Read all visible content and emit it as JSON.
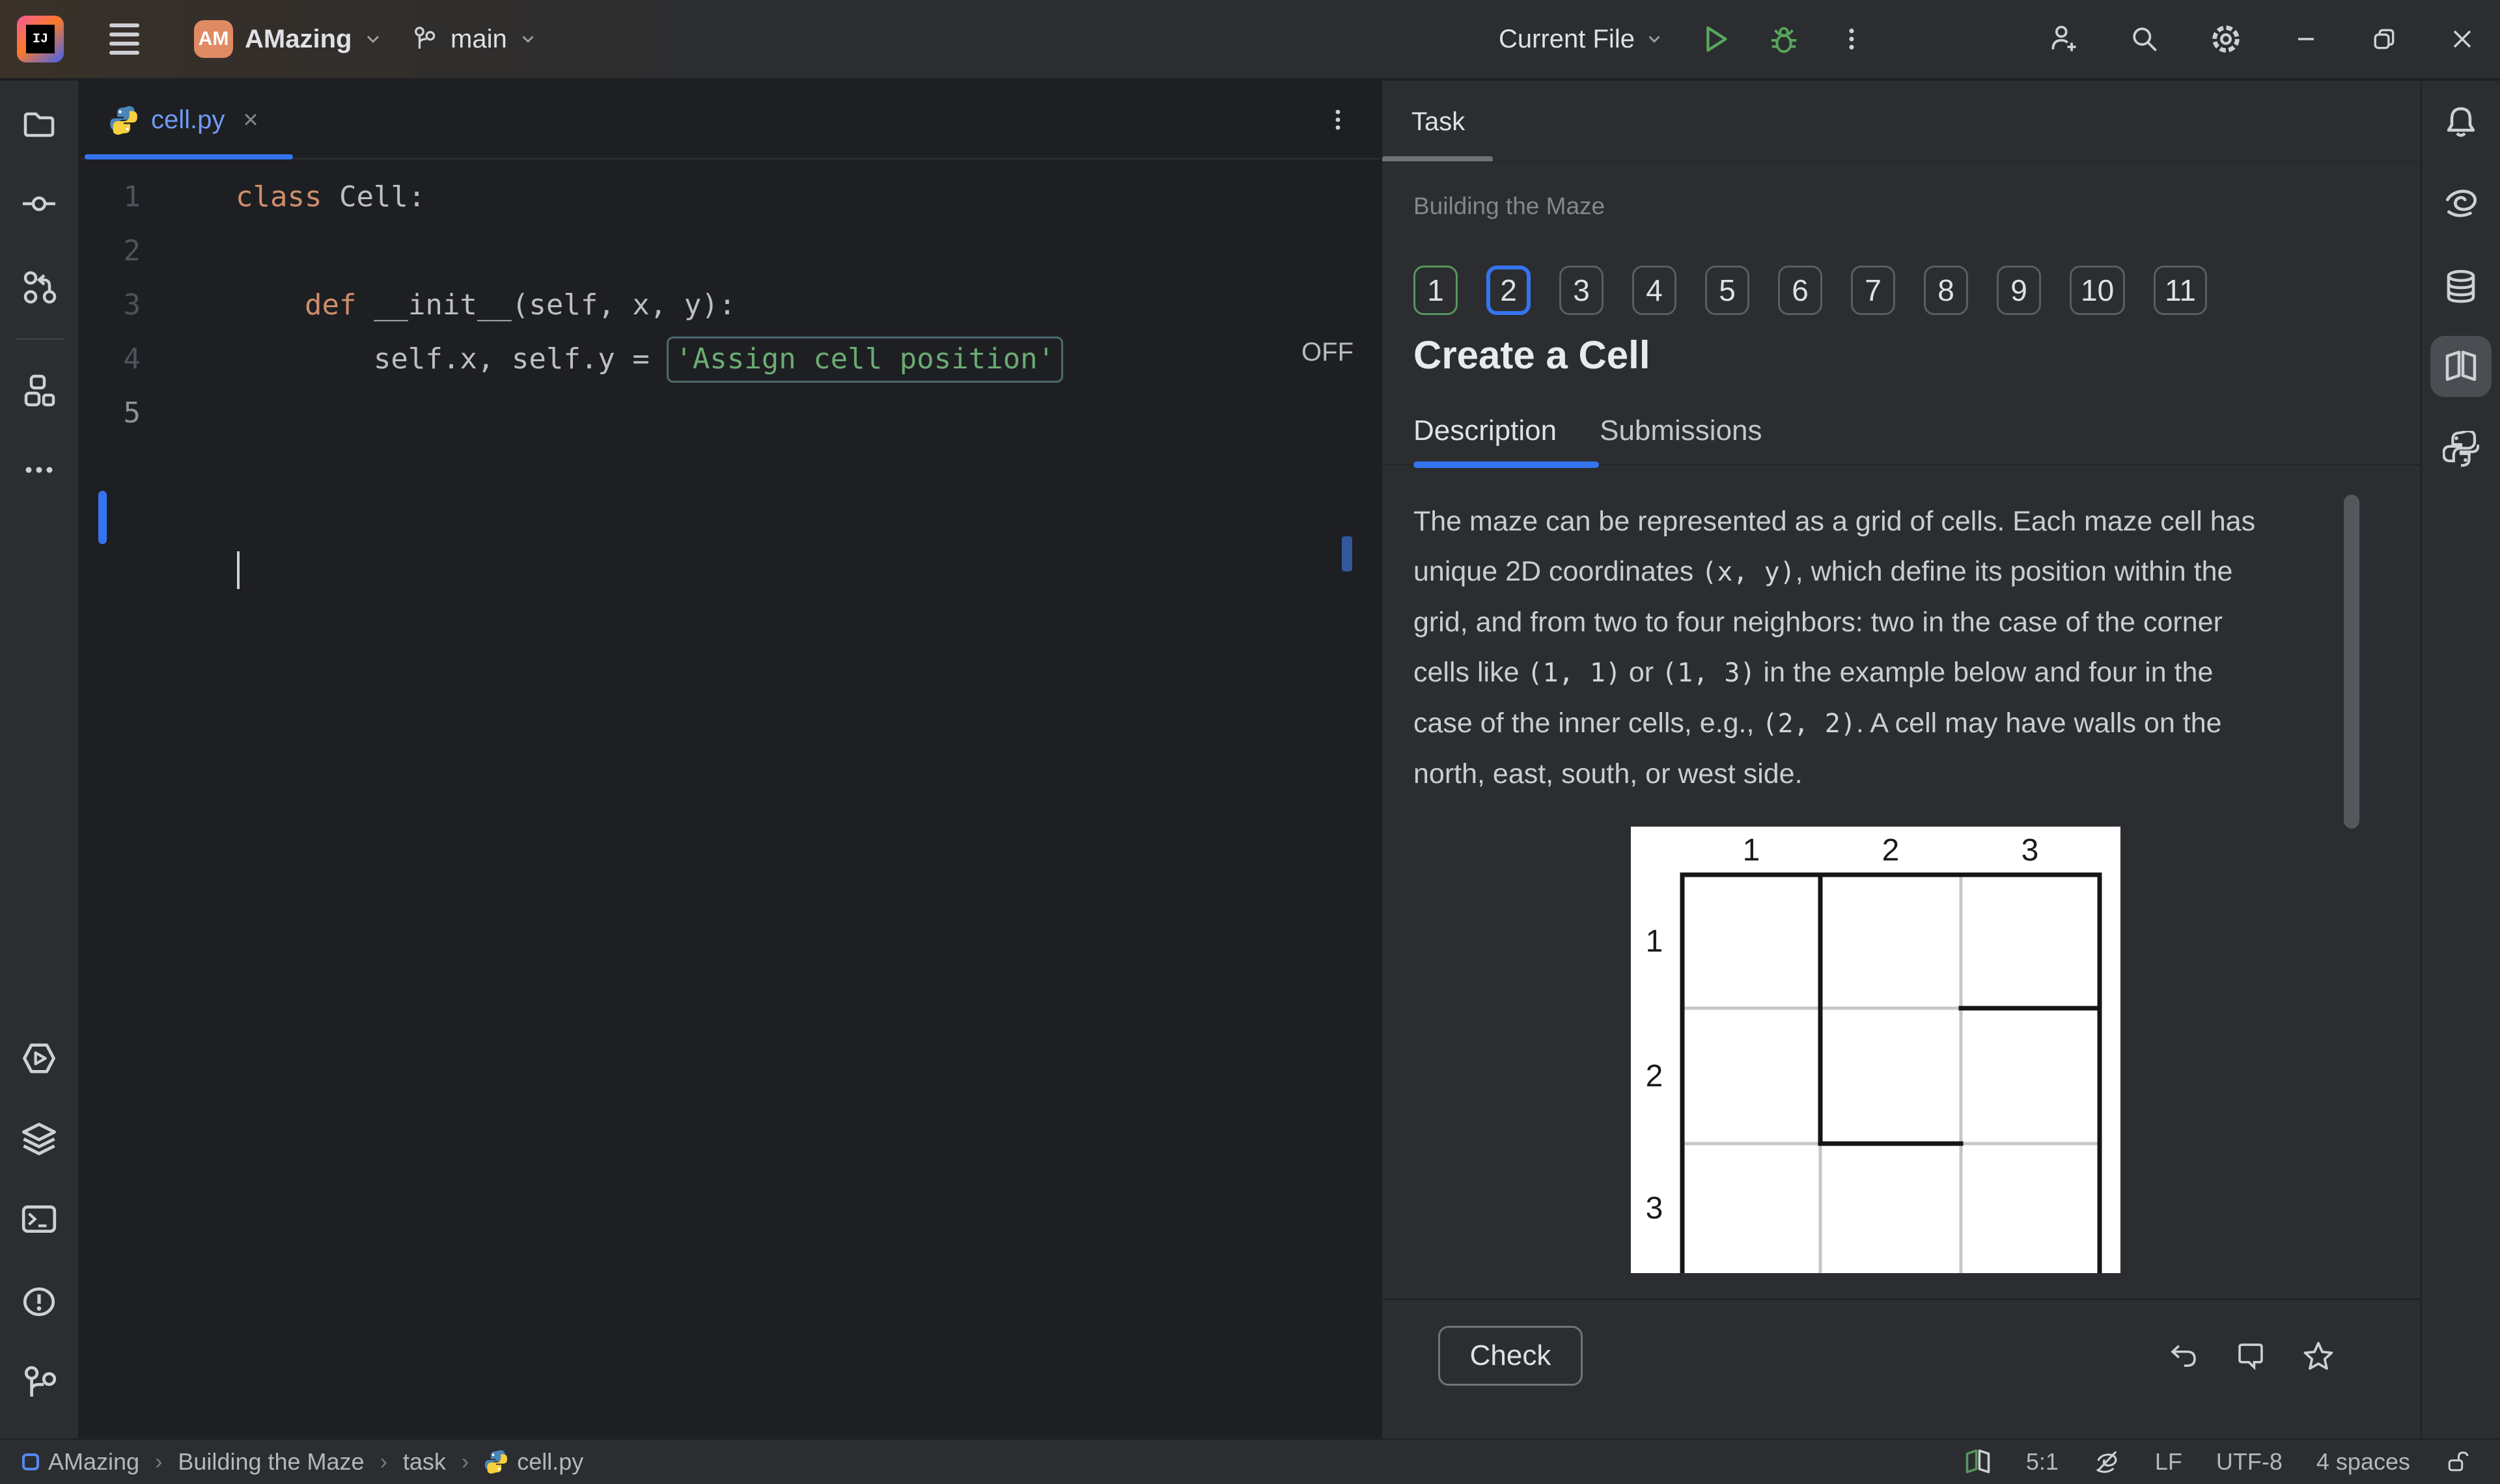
{
  "titlebar": {
    "project_badge": "AM",
    "project_name": "AMazing",
    "branch": "main",
    "run_config": "Current File",
    "icons": [
      "ide-logo",
      "main-menu",
      "project-chevron",
      "branch",
      "run",
      "debug",
      "more-vertical",
      "add-user",
      "search",
      "settings",
      "minimize",
      "restore",
      "close"
    ]
  },
  "colors": {
    "accent": "#3574f0",
    "panel": "#2b2d30",
    "editor": "#1e1f22",
    "keyword": "#cf8e6d",
    "string": "#6aab73",
    "done_green": "#57965c",
    "modified_file_blue": "#6e9bf5",
    "badge_orange": "#e08a63"
  },
  "editor": {
    "tab": {
      "file": "cell.py",
      "close": "×"
    },
    "off_label": "OFF",
    "lines": [
      {
        "gutter": "1",
        "tokens": [
          {
            "t": "class ",
            "s": "kw"
          },
          {
            "t": "Cell:",
            "s": "pl"
          }
        ]
      },
      {
        "gutter": "2",
        "tokens": []
      },
      {
        "gutter": "3",
        "tokens": [
          {
            "t": "    ",
            "s": "pl"
          },
          {
            "t": "def ",
            "s": "kw"
          },
          {
            "t": "__init__(self, x, y):",
            "s": "pl"
          }
        ]
      },
      {
        "gutter": "4",
        "tokens": [
          {
            "t": "        self.x, self.y = ",
            "s": "pl"
          },
          {
            "t": "'Assign cell position'",
            "s": "str-box"
          }
        ]
      },
      {
        "gutter": "5",
        "tokens": [],
        "caret": true
      }
    ]
  },
  "left_strip_icons": [
    "folder",
    "commit",
    "pull-request",
    "structure",
    "more-horizontal",
    "run-hexagon",
    "python-packages",
    "terminal",
    "problems",
    "version-control"
  ],
  "right_strip_icons": [
    "notifications-bell",
    "ai-assistant",
    "database",
    "course-book",
    "python-console"
  ],
  "task_panel": {
    "tool_tab": "Task",
    "lesson": "Building the Maze",
    "steps": {
      "labels": [
        "1",
        "2",
        "3",
        "4",
        "5",
        "6",
        "7",
        "8",
        "9",
        "10",
        "11"
      ],
      "states": [
        "done",
        "current",
        "",
        "",
        "",
        "",
        "",
        "",
        "",
        "",
        ""
      ]
    },
    "title": "Create a Cell",
    "tabs": [
      {
        "label": "Description",
        "active": true
      },
      {
        "label": "Submissions",
        "active": false
      }
    ],
    "paragraph_lines": [
      [
        {
          "t": "The maze can be represented as a grid of cells. Each maze cell has"
        }
      ],
      [
        {
          "t": "unique 2D coordinates "
        },
        {
          "c": "(x, y)"
        },
        {
          "t": ", which define its position within the"
        }
      ],
      [
        {
          "t": "grid, and from two to four neighbors: two in the case of the corner"
        }
      ],
      [
        {
          "t": "cells like "
        },
        {
          "c": "(1, 1)"
        },
        {
          "t": " or "
        },
        {
          "c": "(1, 3)"
        },
        {
          "t": " in the example below and four in the"
        }
      ],
      [
        {
          "t": "case of the inner cells, e.g., "
        },
        {
          "c": "(2, 2)"
        },
        {
          "t": ". A cell may have walls on the"
        }
      ],
      [
        {
          "t": "north, east, south, or west side."
        }
      ]
    ],
    "figure": {
      "col_labels": [
        "1",
        "2",
        "3"
      ],
      "row_labels": [
        "1",
        "2",
        "3"
      ],
      "col_label_x": [
        185,
        399,
        613
      ],
      "row_label_y": [
        192,
        399,
        602
      ],
      "walls_gray": [
        [
          507,
          74,
          507,
          686
        ],
        [
          291,
          487,
          291,
          686
        ],
        [
          79,
          279,
          507,
          279
        ],
        [
          79,
          487,
          291,
          487
        ],
        [
          507,
          487,
          720,
          487
        ]
      ],
      "walls_black": [
        [
          79,
          74,
          720,
          74
        ],
        [
          79,
          74,
          79,
          686
        ],
        [
          720,
          74,
          720,
          686
        ],
        [
          291,
          74,
          291,
          487
        ],
        [
          507,
          279,
          720,
          279
        ],
        [
          291,
          487,
          507,
          487
        ]
      ]
    },
    "check_label": "Check",
    "footer_icons": [
      "reset",
      "comment",
      "favorite-star"
    ]
  },
  "status_bar": {
    "breadcrumbs": [
      "AMazing",
      "Building the Maze",
      "task",
      "cell.py"
    ],
    "separator": "›",
    "caret_position": "5:1",
    "line_ending": "LF",
    "encoding": "UTF-8",
    "indent": "4 spaces",
    "icons": [
      "course-book",
      "ai-completion-off",
      "unlocked"
    ]
  }
}
